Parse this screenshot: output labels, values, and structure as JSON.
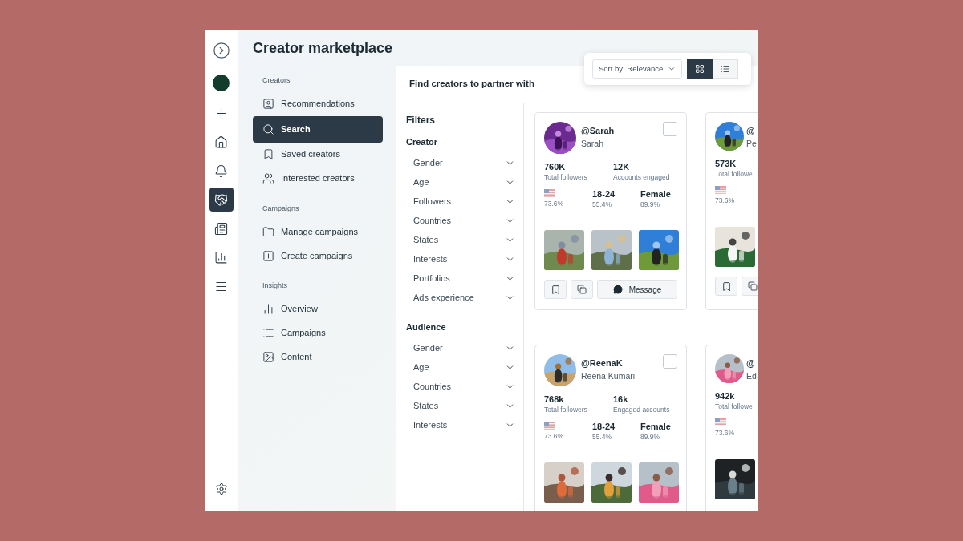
{
  "rail": {
    "items": [
      {
        "kind": "create",
        "selected": false
      },
      {
        "kind": "home",
        "selected": false
      },
      {
        "kind": "notifications",
        "selected": false
      },
      {
        "kind": "marketplace",
        "selected": true
      },
      {
        "kind": "ads",
        "selected": false
      },
      {
        "kind": "insights",
        "selected": false
      },
      {
        "kind": "menu",
        "selected": false
      }
    ],
    "bottom": [
      {
        "kind": "settings",
        "selected": false
      }
    ]
  },
  "page_title": "Creator marketplace",
  "nav": [
    {
      "heading": "Creators",
      "items": [
        {
          "label": "Recommendations",
          "selected": false
        },
        {
          "label": "Search",
          "selected": true
        },
        {
          "label": "Saved creators",
          "selected": false
        },
        {
          "label": "Interested creators",
          "selected": false
        }
      ]
    },
    {
      "heading": "Campaigns",
      "items": [
        {
          "label": "Manage campaigns",
          "selected": false
        },
        {
          "label": "Create campaigns",
          "selected": false
        }
      ]
    },
    {
      "heading": "Insights",
      "items": [
        {
          "label": "Overview",
          "selected": false
        },
        {
          "label": "Campaigns",
          "selected": false
        },
        {
          "label": "Content",
          "selected": false
        }
      ]
    }
  ],
  "panel_title": "Find creators to partner with",
  "sort": {
    "label": "Sort by: Relevance"
  },
  "view_toggle": [
    {
      "kind": "grid",
      "selected": true
    },
    {
      "kind": "list",
      "selected": false
    }
  ],
  "filters": {
    "title": "Filters",
    "groups": [
      {
        "heading": "Creator",
        "items": [
          "Gender",
          "Age",
          "Followers",
          "Countries",
          "States",
          "Interests",
          "Portfolios",
          "Ads experience"
        ]
      },
      {
        "heading": "Audience",
        "items": [
          "Gender",
          "Age",
          "Countries",
          "States",
          "Interests"
        ]
      }
    ]
  },
  "creators": [
    {
      "handle": "@Sarah",
      "name": "Sarah",
      "checked": false,
      "followers": "760K",
      "followers_label": "Total followers",
      "engaged": "12K",
      "engaged_label": "Accounts engaged",
      "country_share": "73.6%",
      "age": "18-24",
      "age_share": "55.4%",
      "gender": "Female",
      "gender_share": "89.9%",
      "photos": [
        {
          "kind": "picture"
        },
        {
          "kind": "picture"
        },
        {
          "kind": "picture"
        }
      ],
      "actions": [
        {
          "kind": "save"
        },
        {
          "kind": "share"
        },
        {
          "kind": "message",
          "label": "Message"
        }
      ]
    },
    {
      "handle": "@",
      "name": "Pe",
      "followers": "573K",
      "followers_label": "Total followe",
      "country_share": "73.6%",
      "photos": [
        {
          "kind": "picture"
        }
      ],
      "actions": [
        {
          "kind": "save"
        },
        {
          "kind": "share"
        }
      ]
    },
    {
      "handle": "@ReenaK",
      "name": "Reena Kumari",
      "checked": false,
      "followers": "768k",
      "followers_label": "Total followers",
      "engaged": "16k",
      "engaged_label": "Engaged accounts",
      "country_share": "73.6%",
      "age": "18-24",
      "age_share": "55.4%",
      "gender": "Female",
      "gender_share": "89.9%",
      "photos": [
        {
          "kind": "picture"
        },
        {
          "kind": "picture"
        },
        {
          "kind": "picture"
        }
      ]
    },
    {
      "handle": "@",
      "name": "Ed",
      "followers": "942k",
      "followers_label": "Total followe",
      "country_share": "73.6%",
      "photos": [
        {
          "kind": "picture"
        }
      ]
    }
  ]
}
